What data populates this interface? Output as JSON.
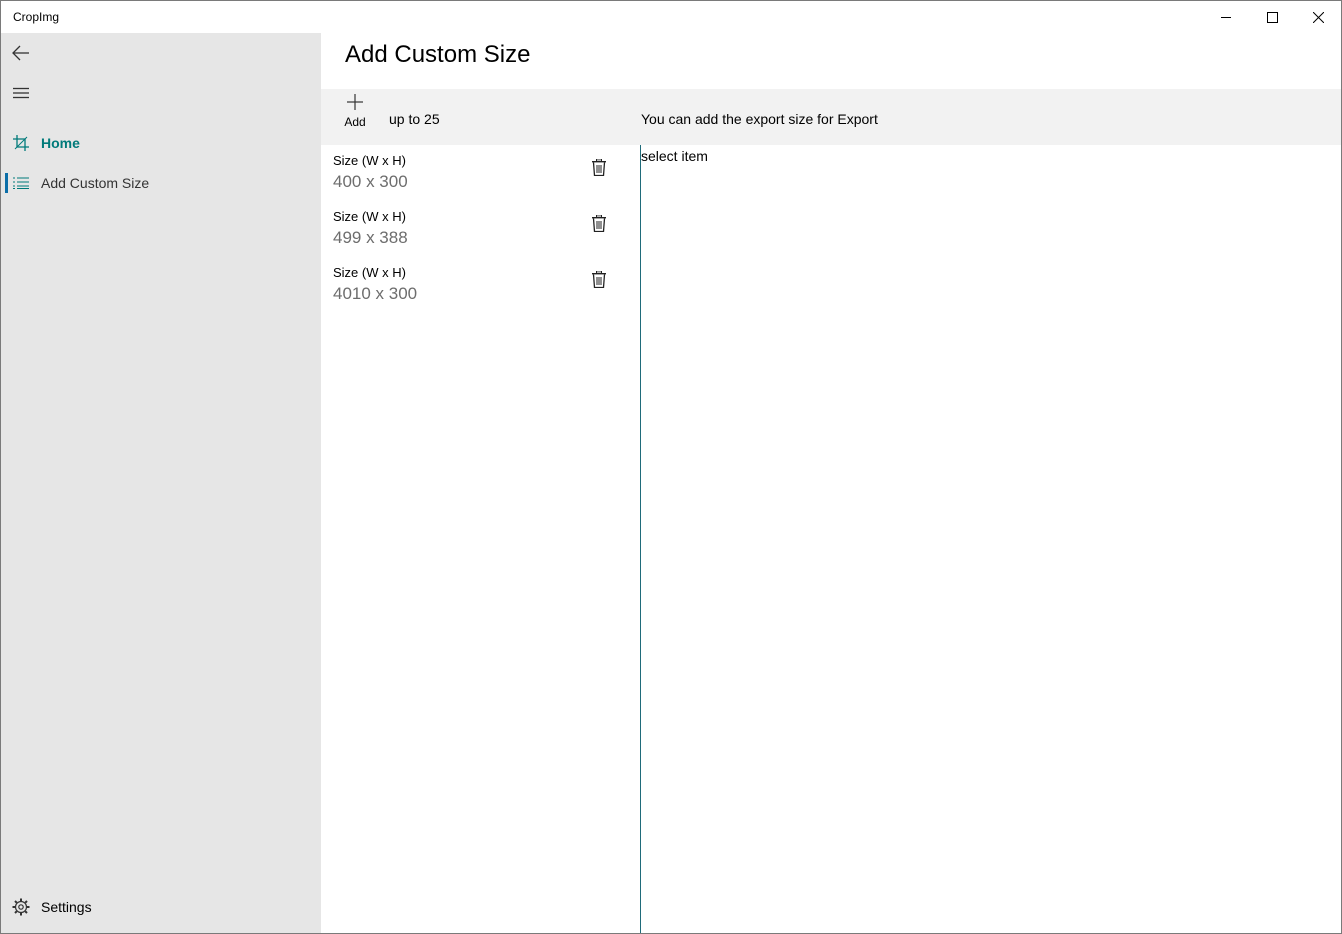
{
  "window": {
    "title": "CropImg",
    "minimize_icon": "minimize-icon",
    "maximize_icon": "maximize-icon",
    "close_icon": "close-icon"
  },
  "sidebar": {
    "back_icon": "back-arrow-icon",
    "menu_icon": "hamburger-menu-icon",
    "items": [
      {
        "label": "Home",
        "icon": "crop-icon",
        "active": true
      },
      {
        "label": "Add Custom Size",
        "icon": "list-icon",
        "active": false
      }
    ],
    "settings": {
      "label": "Settings",
      "icon": "gear-icon"
    }
  },
  "main": {
    "title": "Add Custom Size",
    "toolbar": {
      "add_label": "Add",
      "add_icon": "plus-icon",
      "limit_text": "up to 25",
      "hint_text": "You can add the export size for Export"
    },
    "sizes": [
      {
        "caption": "Size (W x H)",
        "value": "400 x 300"
      },
      {
        "caption": "Size (W x H)",
        "value": "499 x 388"
      },
      {
        "caption": "Size (W x H)",
        "value": "4010 x 300"
      }
    ],
    "detail_text": "select item"
  },
  "colors": {
    "accent": "#007a7a",
    "sidebar_bg": "#e6e6e6",
    "toolbar_bg": "#f2f2f2",
    "divider": "#1f6b7a"
  }
}
